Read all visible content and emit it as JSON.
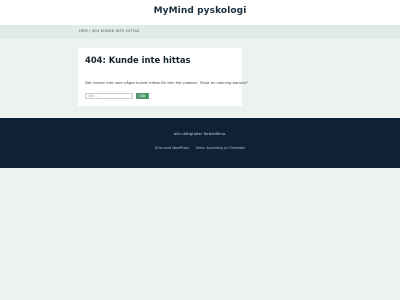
{
  "header": {
    "site_title": "MyMind pyskologi"
  },
  "breadcrumb": {
    "text": "HEM / 404 KUNDE INTE HITTAS"
  },
  "main": {
    "title": "404: Kunde inte hittas",
    "message": "Det verkar inte som något kunde hittas för den här platsen. Testa en sökning kanske?",
    "search": {
      "placeholder": "Sök ...",
      "button_label": "Sök"
    }
  },
  "footer": {
    "copyright": "Alla rättigheter förbehållna.",
    "links": [
      "Drivs med WordPress",
      "Tema: Ascending av Themeisle"
    ]
  },
  "colors": {
    "page_background": "#edf1ef",
    "header_background": "#ffffff",
    "breadcrumb_background": "#e0ebe5",
    "footer_background": "#0f2137",
    "accent_button": "#4e9a6a"
  }
}
